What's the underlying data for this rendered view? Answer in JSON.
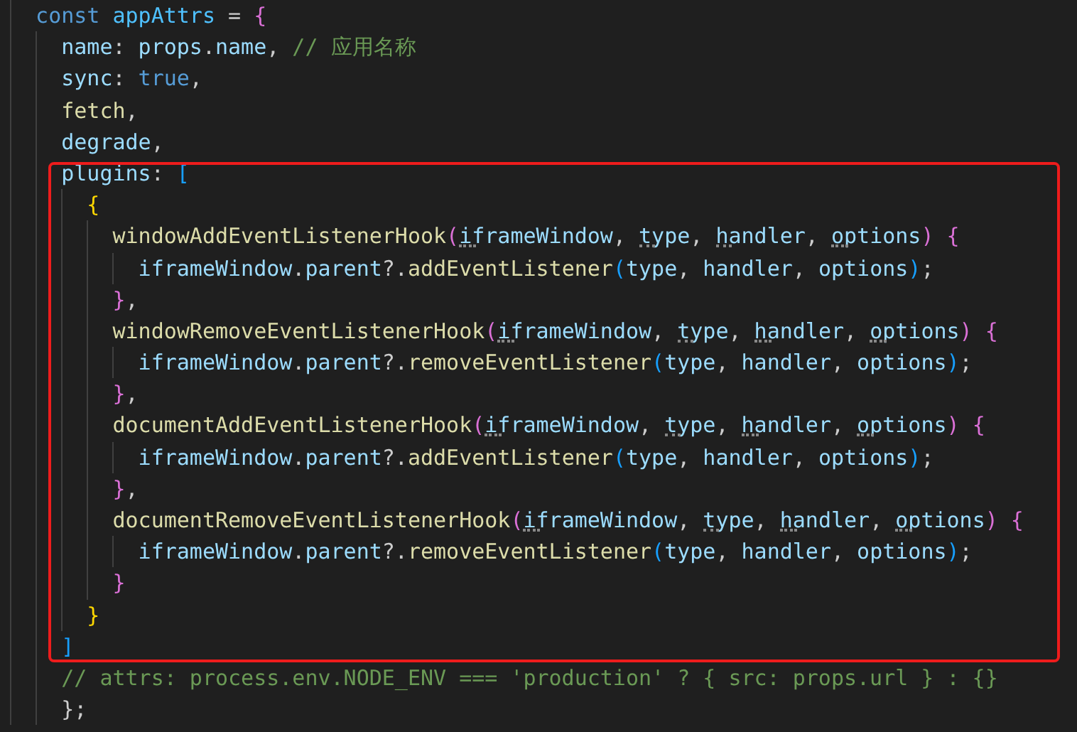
{
  "editor": {
    "lines": [
      {
        "tokens": [
          {
            "text": "const ",
            "kind": "kw"
          },
          {
            "text": "appAttrs",
            "kind": "var"
          },
          {
            "text": " = ",
            "kind": "punct"
          },
          {
            "text": "{",
            "kind": "b1"
          }
        ]
      },
      {
        "tokens": [
          {
            "text": "name",
            "kind": "prop"
          },
          {
            "text": ": ",
            "kind": "punct"
          },
          {
            "text": "props",
            "kind": "prop"
          },
          {
            "text": ".",
            "kind": "punct"
          },
          {
            "text": "name",
            "kind": "prop"
          },
          {
            "text": ", ",
            "kind": "punct"
          },
          {
            "text": "// 应用名称",
            "kind": "comment"
          }
        ]
      },
      {
        "tokens": [
          {
            "text": "sync",
            "kind": "prop"
          },
          {
            "text": ": ",
            "kind": "punct"
          },
          {
            "text": "true",
            "kind": "kw"
          },
          {
            "text": ",",
            "kind": "punct"
          }
        ]
      },
      {
        "tokens": [
          {
            "text": "fetch",
            "kind": "fn"
          },
          {
            "text": ",",
            "kind": "punct"
          }
        ]
      },
      {
        "tokens": [
          {
            "text": "degrade",
            "kind": "prop"
          },
          {
            "text": ",",
            "kind": "punct"
          }
        ]
      },
      {
        "tokens": [
          {
            "text": "plugins",
            "kind": "prop"
          },
          {
            "text": ": ",
            "kind": "punct"
          },
          {
            "text": "[",
            "kind": "b2"
          }
        ]
      },
      {
        "tokens": [
          {
            "text": "{",
            "kind": "b3"
          }
        ]
      },
      {
        "tokens": [
          {
            "text": "windowAddEventListenerHook",
            "kind": "fn"
          },
          {
            "text": "(",
            "kind": "b1"
          },
          {
            "text": "iframeWindow",
            "kind": "param",
            "hint": true
          },
          {
            "text": ", ",
            "kind": "punct"
          },
          {
            "text": "type",
            "kind": "param",
            "hint": true
          },
          {
            "text": ", ",
            "kind": "punct"
          },
          {
            "text": "handler",
            "kind": "param",
            "hint": true
          },
          {
            "text": ", ",
            "kind": "punct"
          },
          {
            "text": "options",
            "kind": "param",
            "hint": true
          },
          {
            "text": ") {",
            "kind": "b1"
          }
        ]
      },
      {
        "tokens": [
          {
            "text": "iframeWindow",
            "kind": "param"
          },
          {
            "text": ".",
            "kind": "punct"
          },
          {
            "text": "parent",
            "kind": "prop"
          },
          {
            "text": "?.",
            "kind": "punct"
          },
          {
            "text": "addEventListener",
            "kind": "fn"
          },
          {
            "text": "(",
            "kind": "b2"
          },
          {
            "text": "type",
            "kind": "param"
          },
          {
            "text": ", ",
            "kind": "punct"
          },
          {
            "text": "handler",
            "kind": "param"
          },
          {
            "text": ", ",
            "kind": "punct"
          },
          {
            "text": "options",
            "kind": "param"
          },
          {
            "text": ")",
            "kind": "b2"
          },
          {
            "text": ";",
            "kind": "punct"
          }
        ]
      },
      {
        "tokens": [
          {
            "text": "}",
            "kind": "b1"
          },
          {
            "text": ",",
            "kind": "punct"
          }
        ]
      },
      {
        "tokens": [
          {
            "text": "windowRemoveEventListenerHook",
            "kind": "fn"
          },
          {
            "text": "(",
            "kind": "b1"
          },
          {
            "text": "iframeWindow",
            "kind": "param",
            "hint": true
          },
          {
            "text": ", ",
            "kind": "punct"
          },
          {
            "text": "type",
            "kind": "param",
            "hint": true
          },
          {
            "text": ", ",
            "kind": "punct"
          },
          {
            "text": "handler",
            "kind": "param",
            "hint": true
          },
          {
            "text": ", ",
            "kind": "punct"
          },
          {
            "text": "options",
            "kind": "param",
            "hint": true
          },
          {
            "text": ") {",
            "kind": "b1"
          }
        ]
      },
      {
        "tokens": [
          {
            "text": "iframeWindow",
            "kind": "param"
          },
          {
            "text": ".",
            "kind": "punct"
          },
          {
            "text": "parent",
            "kind": "prop"
          },
          {
            "text": "?.",
            "kind": "punct"
          },
          {
            "text": "removeEventListener",
            "kind": "fn"
          },
          {
            "text": "(",
            "kind": "b2"
          },
          {
            "text": "type",
            "kind": "param"
          },
          {
            "text": ", ",
            "kind": "punct"
          },
          {
            "text": "handler",
            "kind": "param"
          },
          {
            "text": ", ",
            "kind": "punct"
          },
          {
            "text": "options",
            "kind": "param"
          },
          {
            "text": ")",
            "kind": "b2"
          },
          {
            "text": ";",
            "kind": "punct"
          }
        ]
      },
      {
        "tokens": [
          {
            "text": "}",
            "kind": "b1"
          },
          {
            "text": ",",
            "kind": "punct"
          }
        ]
      },
      {
        "tokens": [
          {
            "text": "documentAddEventListenerHook",
            "kind": "fn"
          },
          {
            "text": "(",
            "kind": "b1"
          },
          {
            "text": "iframeWindow",
            "kind": "param",
            "hint": true
          },
          {
            "text": ", ",
            "kind": "punct"
          },
          {
            "text": "type",
            "kind": "param",
            "hint": true
          },
          {
            "text": ", ",
            "kind": "punct"
          },
          {
            "text": "handler",
            "kind": "param",
            "hint": true
          },
          {
            "text": ", ",
            "kind": "punct"
          },
          {
            "text": "options",
            "kind": "param",
            "hint": true
          },
          {
            "text": ") {",
            "kind": "b1"
          }
        ]
      },
      {
        "tokens": [
          {
            "text": "iframeWindow",
            "kind": "param"
          },
          {
            "text": ".",
            "kind": "punct"
          },
          {
            "text": "parent",
            "kind": "prop"
          },
          {
            "text": "?.",
            "kind": "punct"
          },
          {
            "text": "addEventListener",
            "kind": "fn"
          },
          {
            "text": "(",
            "kind": "b2"
          },
          {
            "text": "type",
            "kind": "param"
          },
          {
            "text": ", ",
            "kind": "punct"
          },
          {
            "text": "handler",
            "kind": "param"
          },
          {
            "text": ", ",
            "kind": "punct"
          },
          {
            "text": "options",
            "kind": "param"
          },
          {
            "text": ")",
            "kind": "b2"
          },
          {
            "text": ";",
            "kind": "punct"
          }
        ]
      },
      {
        "tokens": [
          {
            "text": "}",
            "kind": "b1"
          },
          {
            "text": ",",
            "kind": "punct"
          }
        ]
      },
      {
        "tokens": [
          {
            "text": "documentRemoveEventListenerHook",
            "kind": "fn"
          },
          {
            "text": "(",
            "kind": "b1"
          },
          {
            "text": "iframeWindow",
            "kind": "param",
            "hint": true
          },
          {
            "text": ", ",
            "kind": "punct"
          },
          {
            "text": "type",
            "kind": "param",
            "hint": true
          },
          {
            "text": ", ",
            "kind": "punct"
          },
          {
            "text": "handler",
            "kind": "param",
            "hint": true
          },
          {
            "text": ", ",
            "kind": "punct"
          },
          {
            "text": "options",
            "kind": "param",
            "hint": true
          },
          {
            "text": ") {",
            "kind": "b1"
          }
        ]
      },
      {
        "tokens": [
          {
            "text": "iframeWindow",
            "kind": "param"
          },
          {
            "text": ".",
            "kind": "punct"
          },
          {
            "text": "parent",
            "kind": "prop"
          },
          {
            "text": "?.",
            "kind": "punct"
          },
          {
            "text": "removeEventListener",
            "kind": "fn"
          },
          {
            "text": "(",
            "kind": "b2"
          },
          {
            "text": "type",
            "kind": "param"
          },
          {
            "text": ", ",
            "kind": "punct"
          },
          {
            "text": "handler",
            "kind": "param"
          },
          {
            "text": ", ",
            "kind": "punct"
          },
          {
            "text": "options",
            "kind": "param"
          },
          {
            "text": ")",
            "kind": "b2"
          },
          {
            "text": ";",
            "kind": "punct"
          }
        ]
      },
      {
        "tokens": [
          {
            "text": "}",
            "kind": "b1"
          }
        ]
      },
      {
        "tokens": [
          {
            "text": "}",
            "kind": "b3"
          }
        ]
      },
      {
        "tokens": [
          {
            "text": "]",
            "kind": "b2"
          }
        ]
      },
      {
        "tokens": [
          {
            "text": "// attrs: process.env.NODE_ENV === 'production' ? { src: props.url } : {}",
            "kind": "comment"
          }
        ]
      },
      {
        "tokens": [
          {
            "text": "};",
            "kind": "punct"
          }
        ]
      }
    ]
  }
}
